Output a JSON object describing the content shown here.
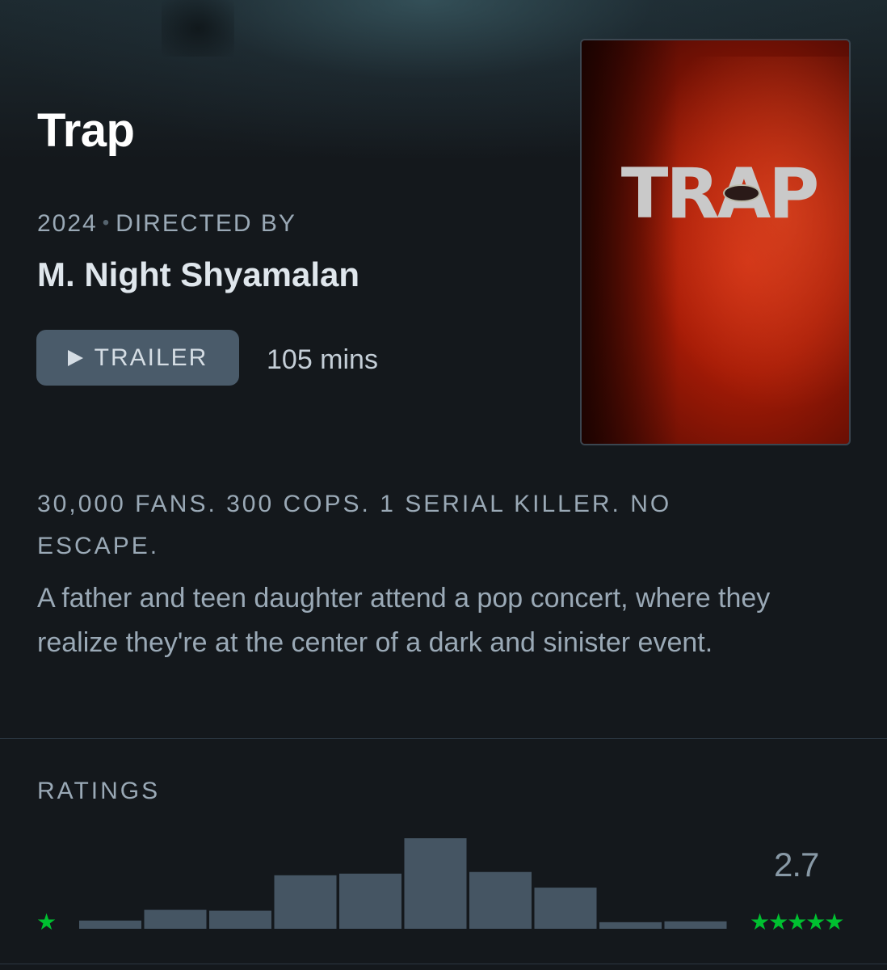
{
  "film": {
    "title": "Trap",
    "year": "2024",
    "directed_by_label": "DIRECTED BY",
    "director": "M. Night Shyamalan",
    "trailer_label": "TRAILER",
    "runtime": "105 mins",
    "poster_title": "TRAP",
    "tagline": "30,000 FANS. 300 COPS. 1 SERIAL KILLER. NO ESCAPE.",
    "synopsis": "A father and teen daughter attend a pop concert, where they realize they're at the center of a dark and sinister event."
  },
  "ratings": {
    "label": "RATINGS",
    "average": "2.7",
    "low_star": "★",
    "high_stars": "★★★★★",
    "star_color": "#00c030"
  },
  "chart_data": {
    "type": "bar",
    "categories": [
      "0.5",
      "1",
      "1.5",
      "2",
      "2.5",
      "3",
      "3.5",
      "4",
      "4.5",
      "5"
    ],
    "values": [
      10,
      23,
      22,
      65,
      67,
      110,
      69,
      50,
      8,
      9
    ],
    "ylim": [
      0,
      110
    ],
    "bar_color": "#455563",
    "grid": false
  },
  "colors": {
    "background": "#14181c",
    "button": "#4a5b6a",
    "muted_text": "#9aa9b6"
  }
}
